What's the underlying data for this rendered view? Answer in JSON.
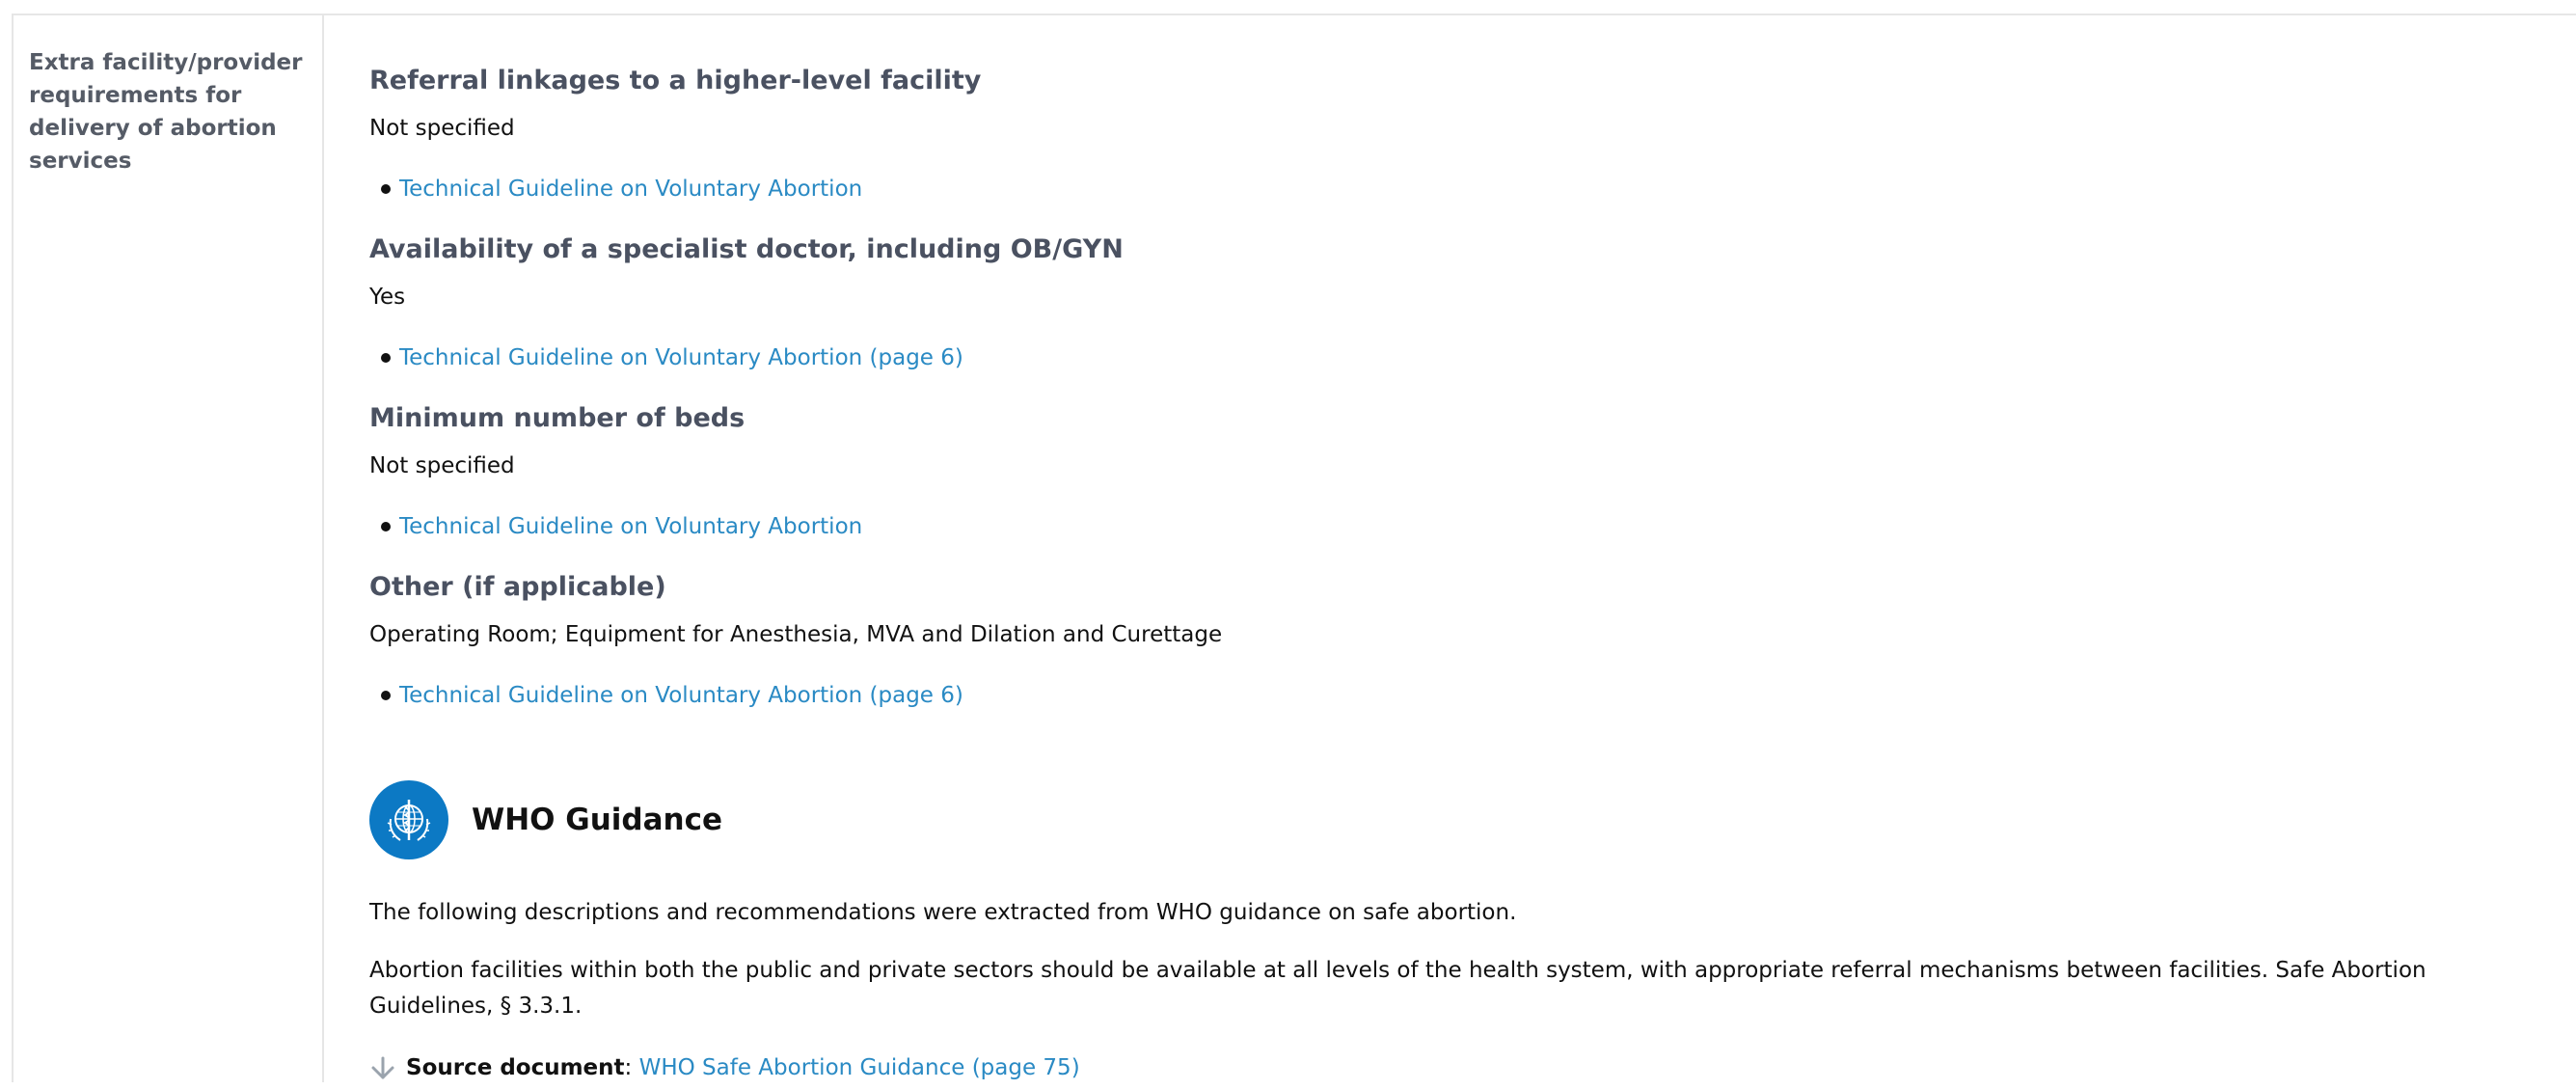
{
  "row": {
    "label": "Extra facility/provider requirements for delivery of abortion services"
  },
  "sections": [
    {
      "title": "Referral linkages to a higher-level facility",
      "value": "Not specified",
      "ref": "Technical Guideline on Voluntary Abortion"
    },
    {
      "title": "Availability of a specialist doctor, including OB/GYN",
      "value": "Yes",
      "ref": "Technical Guideline on Voluntary Abortion (page 6)"
    },
    {
      "title": "Minimum number of beds",
      "value": "Not specified",
      "ref": "Technical Guideline on Voluntary Abortion"
    },
    {
      "title": "Other (if applicable)",
      "value": "Operating Room; Equipment for Anesthesia, MVA and Dilation and Curettage",
      "ref": "Technical Guideline on Voluntary Abortion (page 6)"
    }
  ],
  "who": {
    "title": "WHO Guidance",
    "intro": "The following descriptions and recommendations were extracted from WHO guidance on safe abortion.",
    "body": "Abortion facilities within both the public and private sectors should be available at all levels of the health system, with appropriate referral mechanisms between facilities. Safe Abortion Guidelines, § 3.3.1.",
    "source_label": "Source document",
    "source_sep": ":",
    "source_link": "WHO Safe Abortion Guidance (page 75)",
    "logo_icon": "who-emblem-icon",
    "accent": "#0c79c4",
    "link_color": "#2a8ac4"
  }
}
